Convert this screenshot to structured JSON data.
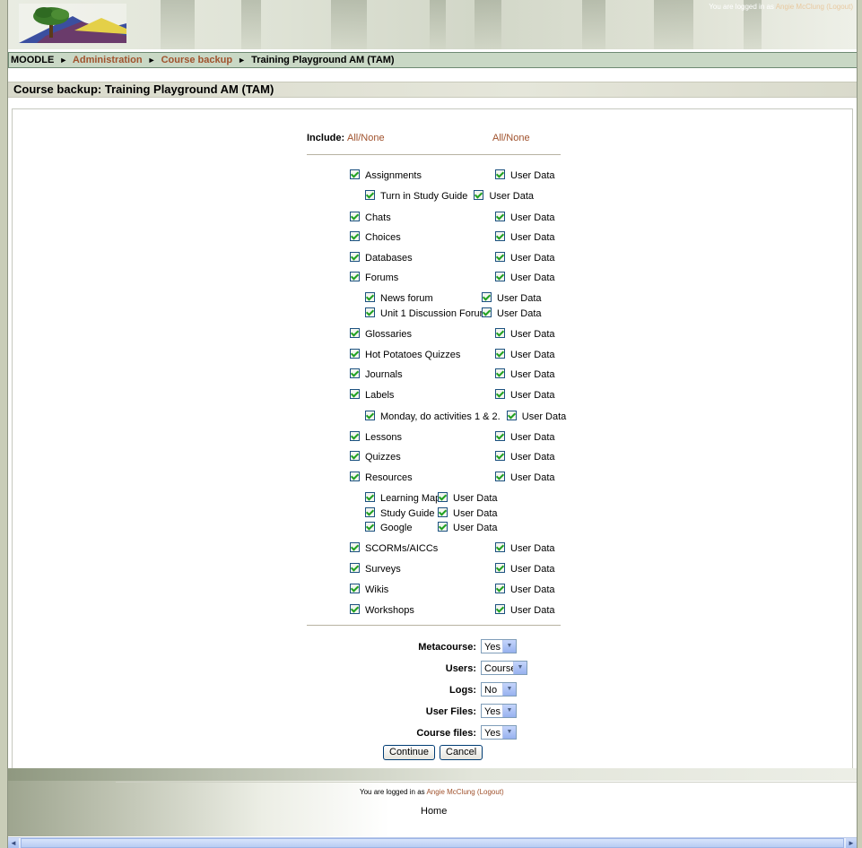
{
  "header": {
    "login_prefix": "You are logged in as ",
    "user_name": "Angie McClung",
    "logout_label": "(Logout)"
  },
  "breadcrumb": {
    "root": "MOODLE",
    "separator": "►",
    "items": [
      "Administration",
      "Course backup"
    ],
    "current": "Training Playground AM (TAM)"
  },
  "page_title": "Course backup: Training Playground AM (TAM)",
  "include": {
    "label": "Include:",
    "all_none_1": "All/None",
    "all_none_2": "All/None"
  },
  "modules": [
    {
      "name": "Assignments",
      "checked": true,
      "userdata": "User Data"
    },
    {
      "name": "Chats",
      "checked": true,
      "userdata": "User Data"
    },
    {
      "name": "Choices",
      "checked": true,
      "userdata": "User Data"
    },
    {
      "name": "Databases",
      "checked": true,
      "userdata": "User Data"
    },
    {
      "name": "Forums",
      "checked": true,
      "userdata": "User Data"
    },
    {
      "name": "Glossaries",
      "checked": true,
      "userdata": "User Data"
    },
    {
      "name": "Hot Potatoes Quizzes",
      "checked": true,
      "userdata": "User Data"
    },
    {
      "name": "Journals",
      "checked": true,
      "userdata": "User Data"
    },
    {
      "name": "Labels",
      "checked": true,
      "userdata": "User Data"
    },
    {
      "name": "Lessons",
      "checked": true,
      "userdata": "User Data"
    },
    {
      "name": "Quizzes",
      "checked": true,
      "userdata": "User Data"
    },
    {
      "name": "Resources",
      "checked": true,
      "userdata": "User Data"
    },
    {
      "name": "SCORMs/AICCs",
      "checked": true,
      "userdata": "User Data"
    },
    {
      "name": "Surveys",
      "checked": true,
      "userdata": "User Data"
    },
    {
      "name": "Wikis",
      "checked": true,
      "userdata": "User Data"
    },
    {
      "name": "Workshops",
      "checked": true,
      "userdata": "User Data"
    }
  ],
  "instances": {
    "assignments": [
      {
        "name": "Turn in Study Guide",
        "userdata": "User Data"
      }
    ],
    "forums": [
      {
        "name": "News forum",
        "userdata": "User Data"
      },
      {
        "name": "Unit 1 Discussion Forum",
        "userdata": "User Data"
      }
    ],
    "labels": [
      {
        "name": "Monday, do activities 1 & 2.",
        "userdata": "User Data"
      }
    ],
    "resources": [
      {
        "name": "Learning Map",
        "userdata": "User Data"
      },
      {
        "name": "Study Guide",
        "userdata": "User Data"
      },
      {
        "name": "Google",
        "userdata": "User Data"
      }
    ]
  },
  "options": [
    {
      "label": "Metacourse:",
      "value": "Yes"
    },
    {
      "label": "Users:",
      "value": "Course"
    },
    {
      "label": "Logs:",
      "value": "No"
    },
    {
      "label": "User Files:",
      "value": "Yes"
    },
    {
      "label": "Course files:",
      "value": "Yes"
    }
  ],
  "buttons": {
    "continue": "Continue",
    "cancel": "Cancel"
  },
  "footer": {
    "login_prefix": "You are logged in as ",
    "user_name": "Angie McClung",
    "logout_label": "(Logout)",
    "home": "Home"
  },
  "colors": {
    "link": "#a0522d",
    "navbar_bg": "#c9d8c5"
  }
}
